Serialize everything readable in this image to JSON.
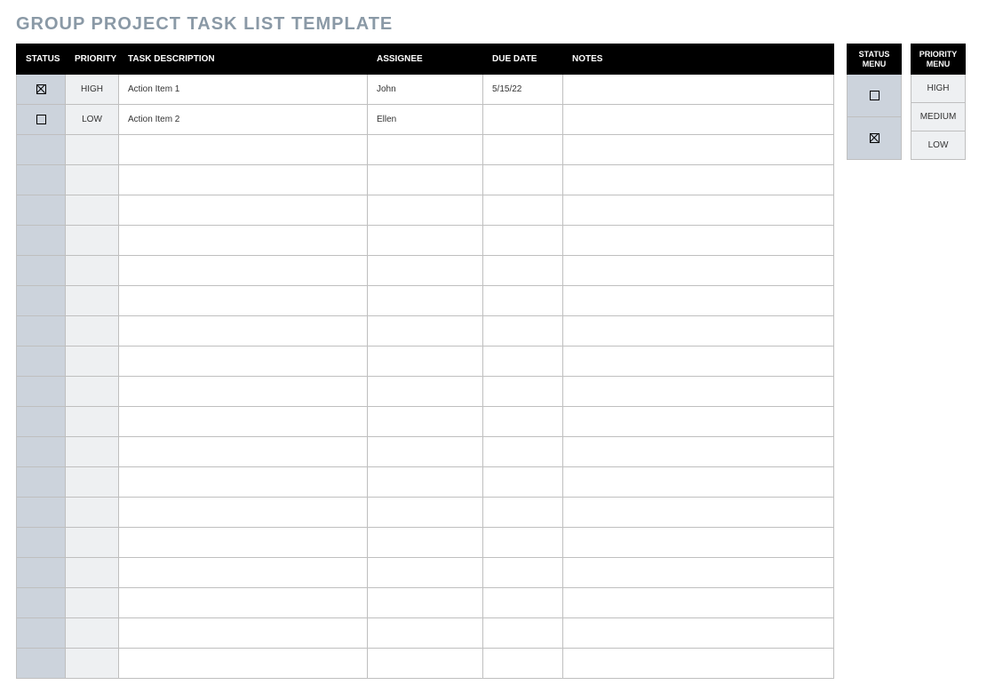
{
  "title": "GROUP PROJECT TASK LIST TEMPLATE",
  "table": {
    "headers": {
      "status": "STATUS",
      "priority": "PRIORITY",
      "task": "TASK DESCRIPTION",
      "assignee": "ASSIGNEE",
      "due": "DUE DATE",
      "notes": "NOTES"
    },
    "rows": [
      {
        "status_checked": true,
        "priority": "HIGH",
        "task": "Action Item 1",
        "assignee": "John",
        "due": "5/15/22",
        "notes": ""
      },
      {
        "status_checked": false,
        "priority": "LOW",
        "task": "Action Item 2",
        "assignee": "Ellen",
        "due": "",
        "notes": ""
      },
      {
        "status_checked": null,
        "priority": "",
        "task": "",
        "assignee": "",
        "due": "",
        "notes": ""
      },
      {
        "status_checked": null,
        "priority": "",
        "task": "",
        "assignee": "",
        "due": "",
        "notes": ""
      },
      {
        "status_checked": null,
        "priority": "",
        "task": "",
        "assignee": "",
        "due": "",
        "notes": ""
      },
      {
        "status_checked": null,
        "priority": "",
        "task": "",
        "assignee": "",
        "due": "",
        "notes": ""
      },
      {
        "status_checked": null,
        "priority": "",
        "task": "",
        "assignee": "",
        "due": "",
        "notes": ""
      },
      {
        "status_checked": null,
        "priority": "",
        "task": "",
        "assignee": "",
        "due": "",
        "notes": ""
      },
      {
        "status_checked": null,
        "priority": "",
        "task": "",
        "assignee": "",
        "due": "",
        "notes": ""
      },
      {
        "status_checked": null,
        "priority": "",
        "task": "",
        "assignee": "",
        "due": "",
        "notes": ""
      },
      {
        "status_checked": null,
        "priority": "",
        "task": "",
        "assignee": "",
        "due": "",
        "notes": ""
      },
      {
        "status_checked": null,
        "priority": "",
        "task": "",
        "assignee": "",
        "due": "",
        "notes": ""
      },
      {
        "status_checked": null,
        "priority": "",
        "task": "",
        "assignee": "",
        "due": "",
        "notes": ""
      },
      {
        "status_checked": null,
        "priority": "",
        "task": "",
        "assignee": "",
        "due": "",
        "notes": ""
      },
      {
        "status_checked": null,
        "priority": "",
        "task": "",
        "assignee": "",
        "due": "",
        "notes": ""
      },
      {
        "status_checked": null,
        "priority": "",
        "task": "",
        "assignee": "",
        "due": "",
        "notes": ""
      },
      {
        "status_checked": null,
        "priority": "",
        "task": "",
        "assignee": "",
        "due": "",
        "notes": ""
      },
      {
        "status_checked": null,
        "priority": "",
        "task": "",
        "assignee": "",
        "due": "",
        "notes": ""
      },
      {
        "status_checked": null,
        "priority": "",
        "task": "",
        "assignee": "",
        "due": "",
        "notes": ""
      },
      {
        "status_checked": null,
        "priority": "",
        "task": "",
        "assignee": "",
        "due": "",
        "notes": ""
      }
    ]
  },
  "legend": {
    "status": {
      "header": "STATUS MENU",
      "items": [
        {
          "checked": false
        },
        {
          "checked": true
        }
      ]
    },
    "priority": {
      "header": "PRIORITY MENU",
      "items": [
        {
          "label": "HIGH"
        },
        {
          "label": "MEDIUM"
        },
        {
          "label": "LOW"
        }
      ]
    }
  }
}
